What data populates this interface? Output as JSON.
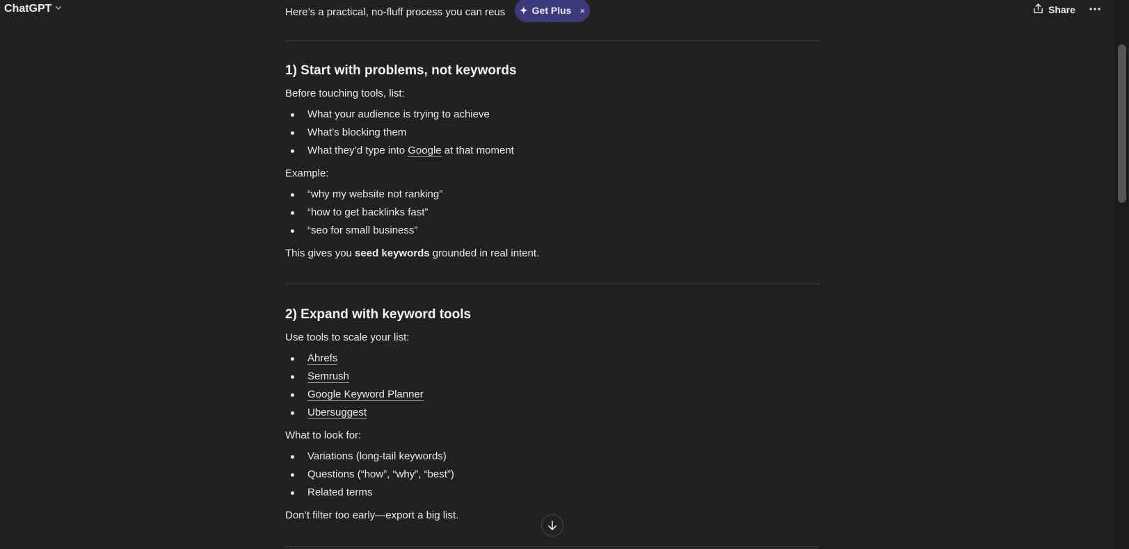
{
  "header": {
    "model_name": "ChatGPT",
    "share_label": "Share"
  },
  "promo": {
    "label": "Get Plus",
    "close": "×"
  },
  "intro": "Here’s a practical, no-fluff process you can reus",
  "section1": {
    "title": "1) Start with problems, not keywords",
    "lead": "Before touching tools, list:",
    "items": [
      "What your audience is trying to achieve",
      "What’s blocking them"
    ],
    "item3_before": "What they’d type into ",
    "item3_link": "Google",
    "item3_after": " at that moment",
    "example_label": "Example:",
    "examples": [
      "“why my website not ranking”",
      "“how to get backlinks fast”",
      "“seo for small business”"
    ],
    "summary_before": "This gives you ",
    "summary_bold": "seed keywords",
    "summary_after": " grounded in real intent."
  },
  "section2": {
    "title": "2) Expand with keyword tools",
    "lead": "Use tools to scale your list:",
    "tools": [
      "Ahrefs",
      "Semrush",
      "Google Keyword Planner",
      "Ubersuggest"
    ],
    "look_for_label": "What to look for:",
    "look_for": [
      "Variations (long-tail keywords)",
      "Questions (“how”, “why”, “best”)",
      "Related terms"
    ],
    "closing": "Don’t filter too early—export a big list."
  }
}
